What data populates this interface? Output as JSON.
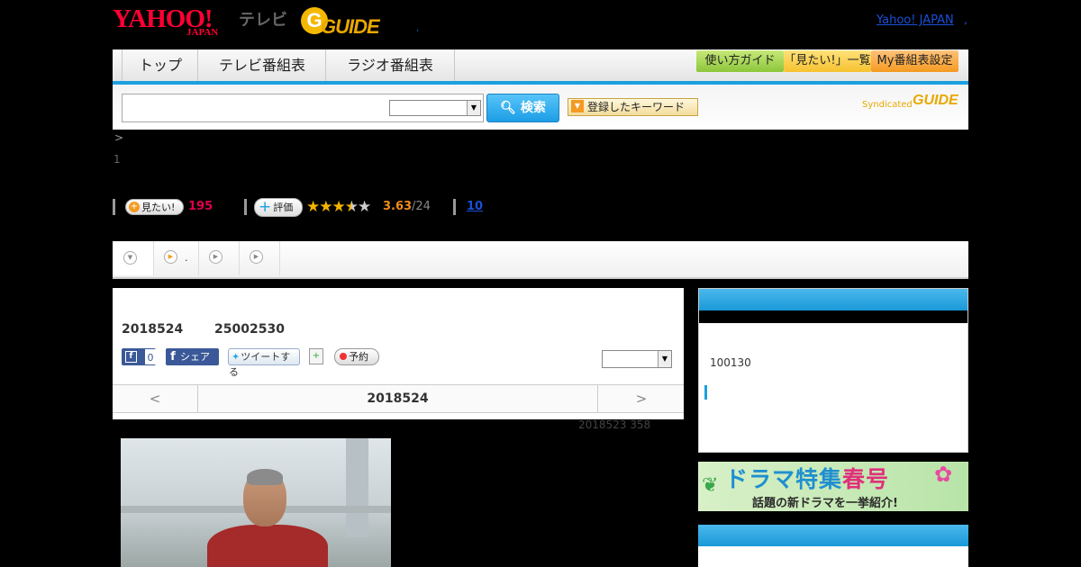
{
  "header": {
    "yahoo_logo": "YAHOO!",
    "yahoo_sub": "JAPAN",
    "tv_label": "テレビ",
    "gguide_logo": "GUIDE",
    "dot": ",",
    "yahoo_japan_link": "Yahoo! JAPAN",
    "dot2": ","
  },
  "nav": {
    "tabs": [
      "トップ",
      "テレビ番組表",
      "ラジオ番組表"
    ],
    "buttons": [
      "使い方ガイド",
      "「見たい!」一覧",
      "My番組表設定"
    ]
  },
  "search": {
    "input_value": "",
    "select_value": "",
    "button_label": "検索",
    "keyword_label": "登録したキーワード",
    "syndicated_text": "Syndicated",
    "syndicated_logo": "GUIDE"
  },
  "breadcrumb": {
    "separator": ">"
  },
  "episode": {
    "number": "1"
  },
  "stats": {
    "mitai_label": "見たい!",
    "mitai_count": "195",
    "eval_label": "評価",
    "rating": 3.63,
    "rating_text": "3.63",
    "rating_count": "/24",
    "review_count": "10"
  },
  "tabs": {
    "tab1_dot": "."
  },
  "program": {
    "date": "2018524",
    "time": "25002530",
    "fb_like_count": "0",
    "fb_share_label": "シェア",
    "tweet_label": "ツイートする",
    "reserve_label": "予約",
    "select_value": ""
  },
  "day_nav": {
    "prev": "<",
    "current": "2018524",
    "next": ">"
  },
  "rerun_note": "2018523  358",
  "sidebar": {
    "text": "100130",
    "banner_title_1": "ドラマ特集",
    "banner_title_2": "春号",
    "banner_sub": "話題の新ドラマを一挙紹介!"
  },
  "colors": {
    "accent_blue": "#1ba0e0",
    "yahoo_red": "#ff0033",
    "mitai_pink": "#e0004c",
    "rating_orange": "#f08c1a"
  }
}
